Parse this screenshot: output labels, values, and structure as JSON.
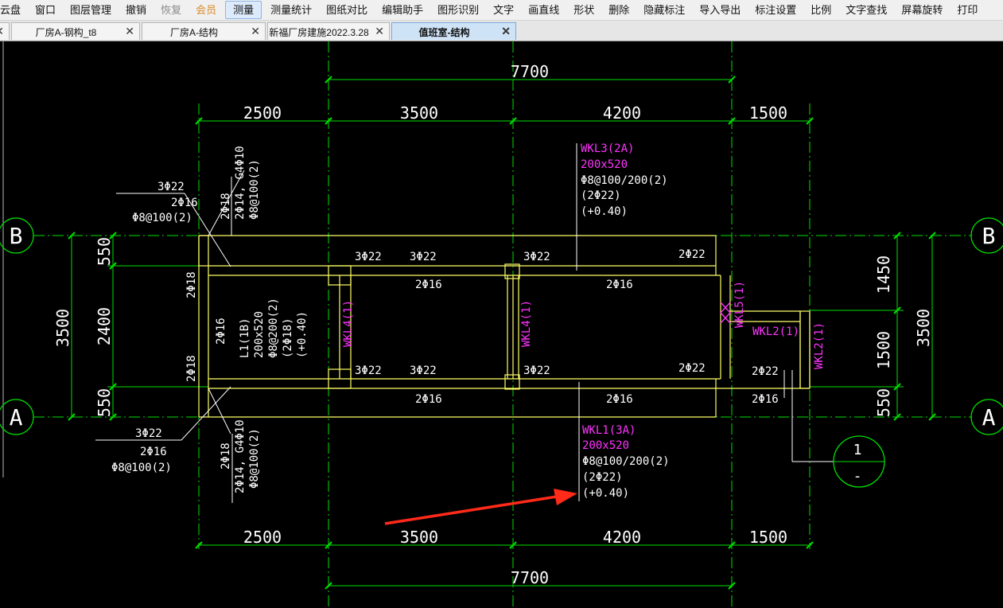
{
  "menubar": {
    "items": [
      {
        "label": "云盘",
        "state": "normal"
      },
      {
        "label": "窗口",
        "state": "normal"
      },
      {
        "label": "图层管理",
        "state": "normal"
      },
      {
        "label": "撤销",
        "state": "normal"
      },
      {
        "label": "恢复",
        "state": "disabled"
      },
      {
        "label": "会员",
        "state": "vip"
      },
      {
        "label": "测量",
        "state": "active"
      },
      {
        "label": "测量统计",
        "state": "normal"
      },
      {
        "label": "图纸对比",
        "state": "normal"
      },
      {
        "label": "编辑助手",
        "state": "normal"
      },
      {
        "label": "图形识别",
        "state": "normal"
      },
      {
        "label": "文字",
        "state": "normal"
      },
      {
        "label": "画直线",
        "state": "normal"
      },
      {
        "label": "形状",
        "state": "normal"
      },
      {
        "label": "删除",
        "state": "normal"
      },
      {
        "label": "隐藏标注",
        "state": "normal"
      },
      {
        "label": "导入导出",
        "state": "normal"
      },
      {
        "label": "标注设置",
        "state": "normal"
      },
      {
        "label": "比例",
        "state": "normal"
      },
      {
        "label": "文字查找",
        "state": "normal"
      },
      {
        "label": "屏幕旋转",
        "state": "normal"
      },
      {
        "label": "打印",
        "state": "normal"
      }
    ]
  },
  "tabs": [
    {
      "label": "",
      "close": "✕",
      "active": false
    },
    {
      "label": "厂房A-钢构_t8",
      "close": "✕",
      "active": false
    },
    {
      "label": "厂房A-结构",
      "close": "✕",
      "active": false
    },
    {
      "label": "新福厂房建施2022.3.28",
      "close": "✕",
      "active": false
    },
    {
      "label": "值班室-结构",
      "close": "✕",
      "active": true
    }
  ],
  "drawing": {
    "colors": {
      "background": "#000000",
      "dimension": "#00e000",
      "beam": "#ffff66",
      "text": "#ffffff",
      "beam_label": "#ff33ff",
      "arrow": "#ff2a1a"
    },
    "dims_top": {
      "overall": "7700",
      "spans": [
        "2500",
        "3500",
        "4200",
        "1500"
      ]
    },
    "dims_bottom": {
      "overall": "7700",
      "spans": [
        "2500",
        "3500",
        "4200",
        "1500"
      ]
    },
    "dims_left": {
      "overall": "3500",
      "spans": [
        "550",
        "2400",
        "550"
      ]
    },
    "dims_right": {
      "overall": "3500",
      "spans": [
        "1450",
        "1500",
        "550"
      ]
    },
    "axes": {
      "b": "B",
      "a": "A"
    },
    "section": {
      "number": "1",
      "sheet": "-"
    },
    "wkl3": {
      "name": "WKL3(2A)",
      "size": "200x520",
      "stirrup": "Φ8@100/200(2)",
      "through": "(2Φ22)",
      "elev": "(+0.40)"
    },
    "wkl1": {
      "name": "WKL1(3A)",
      "size": "200x520",
      "stirrup": "Φ8@100/200(2)",
      "through": "(2Φ22)",
      "elev": "(+0.40)"
    },
    "l1": {
      "name": "L1(1B)",
      "size": "200x520",
      "stirrup": "Φ8@200(2)",
      "through": "(2Φ18)",
      "elev": "(+0.40)"
    },
    "beam_names": {
      "wkl4": "WKL4(1)",
      "wkl5": "WKL5(1)",
      "wkl2": "WKL2(1)"
    },
    "rebar": {
      "top3": "3Φ22",
      "bot2": "2Φ16",
      "top2": "2Φ22",
      "side2": "2Φ18",
      "stir100": "Φ8@100(2)",
      "diag_top": "2Φ14, G4Φ10",
      "diag_bot": "Φ8@100(2)"
    }
  }
}
